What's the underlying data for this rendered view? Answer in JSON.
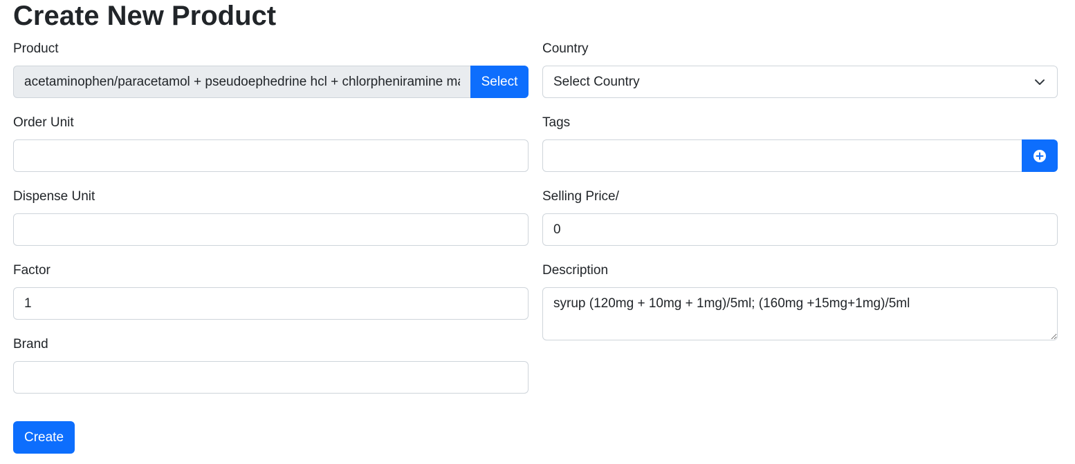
{
  "page": {
    "title": "Create New Product"
  },
  "form": {
    "product": {
      "label": "Product",
      "value": "acetaminophen/paracetamol + pseudoephedrine hcl + chlorpheniramine maleate",
      "select_button": "Select"
    },
    "country": {
      "label": "Country",
      "selected": "Select Country",
      "icon": "chevron-down-icon"
    },
    "order_unit": {
      "label": "Order Unit",
      "value": ""
    },
    "tags": {
      "label": "Tags",
      "value": "",
      "add_icon": "plus-circle-icon"
    },
    "dispense_unit": {
      "label": "Dispense Unit",
      "value": ""
    },
    "selling_price": {
      "label": "Selling Price/",
      "value": "0"
    },
    "factor": {
      "label": "Factor",
      "value": "1"
    },
    "description": {
      "label": "Description",
      "value": "syrup (120mg + 10mg + 1mg)/5ml; (160mg +15mg+1mg)/5ml"
    },
    "brand": {
      "label": "Brand",
      "value": ""
    },
    "create_button": "Create"
  },
  "colors": {
    "primary": "#0d6efd",
    "readonly_bg": "#e9ecef",
    "border": "#ced4da",
    "text": "#212529"
  }
}
